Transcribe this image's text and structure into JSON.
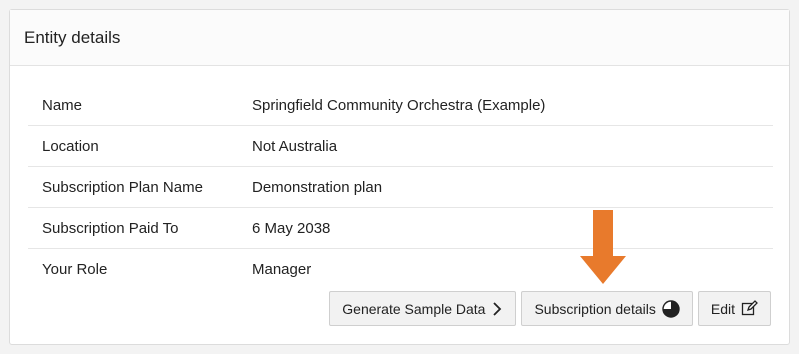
{
  "panel": {
    "title": "Entity details"
  },
  "details": [
    {
      "label": "Name",
      "value": "Springfield Community Orchestra (Example)"
    },
    {
      "label": "Location",
      "value": "Not Australia"
    },
    {
      "label": "Subscription Plan Name",
      "value": "Demonstration plan"
    },
    {
      "label": "Subscription Paid To",
      "value": "6 May 2038"
    },
    {
      "label": "Your Role",
      "value": "Manager"
    }
  ],
  "buttons": {
    "generate_label": "Generate Sample Data",
    "generate_icon": "chevron-right-icon",
    "subscription_label": "Subscription details",
    "subscription_icon": "pie-chart-icon",
    "edit_label": "Edit",
    "edit_icon": "edit-icon"
  },
  "annotation": {
    "arrow_color": "#e87a2c",
    "arrow_icon": "down-arrow-icon"
  }
}
